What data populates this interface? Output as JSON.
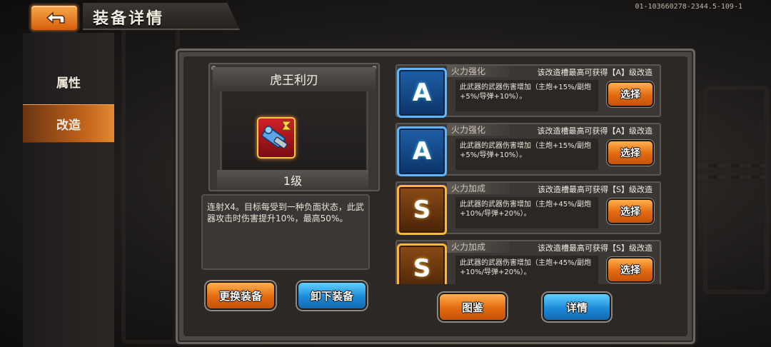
{
  "header": {
    "back_label": "",
    "title": "装备详情",
    "build_id": "01-103660278-2344.5-109-1"
  },
  "nav": {
    "items": [
      {
        "label": "属性",
        "active": false
      },
      {
        "label": "改造",
        "active": true
      }
    ]
  },
  "weapon": {
    "name": "虎王利刃",
    "level": "1级",
    "description": "连射X4。目标每受到一种负面状态，此武器攻击时伤害提升10%，最高50%。"
  },
  "actions": {
    "replace_label": "更换装备",
    "unequip_label": "卸下装备",
    "catalog_label": "图鉴",
    "details_label": "详情"
  },
  "mods": [
    {
      "grade": "A",
      "grade_color": "blue",
      "name": "火力强化",
      "info": "该改造槽最高可获得【A】级改造",
      "desc": "此武器的武器伤害增加（主炮+15%/副炮+5%/导弹+10%）。",
      "button": "选择"
    },
    {
      "grade": "A",
      "grade_color": "blue",
      "name": "火力强化",
      "info": "该改造槽最高可获得【A】级改造",
      "desc": "此武器的武器伤害增加（主炮+15%/副炮+5%/导弹+10%）。",
      "button": "选择"
    },
    {
      "grade": "S",
      "grade_color": "gold",
      "name": "火力加成",
      "info": "该改造槽最高可获得【S】级改造",
      "desc": "此武器的武器伤害增加（主炮+45%/副炮+10%/导弹+20%）。",
      "button": "选择"
    },
    {
      "grade": "S",
      "grade_color": "gold",
      "name": "火力加成",
      "info": "该改造槽最高可获得【S】级改造",
      "desc": "此武器的武器伤害增加（主炮+45%/副炮+10%/导弹+20%）。",
      "button": "选择"
    }
  ],
  "colors": {
    "accent_orange": "#e26a10",
    "accent_blue": "#1d8ad9",
    "grade_a": "#5fb6ff",
    "grade_s": "#ffb739"
  }
}
